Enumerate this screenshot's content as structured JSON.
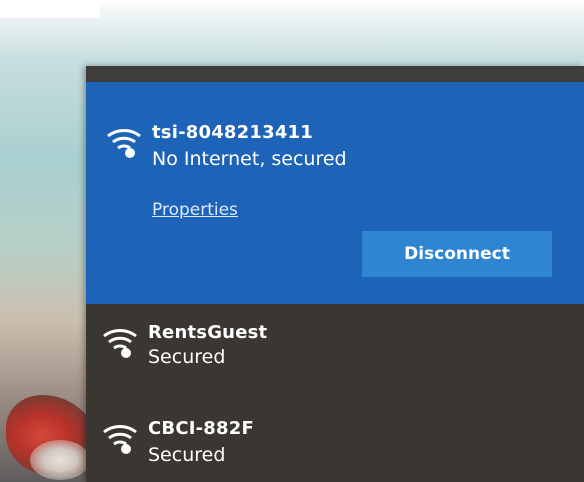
{
  "colors": {
    "flyout_bg": "#3a3632",
    "selected_bg": "#1d64b8",
    "button_bg": "#2e86d3",
    "text": "#ffffff",
    "link": "#dfe9ff"
  },
  "connected_network": {
    "icon": "wifi-secured-icon",
    "ssid": "tsi-8048213411",
    "status": "No Internet, secured",
    "properties_label": "Properties",
    "disconnect_label": "Disconnect"
  },
  "networks": [
    {
      "icon": "wifi-secured-icon",
      "ssid": "RentsGuest",
      "status": "Secured"
    },
    {
      "icon": "wifi-secured-icon",
      "ssid": "CBCI-882F",
      "status": "Secured"
    }
  ]
}
